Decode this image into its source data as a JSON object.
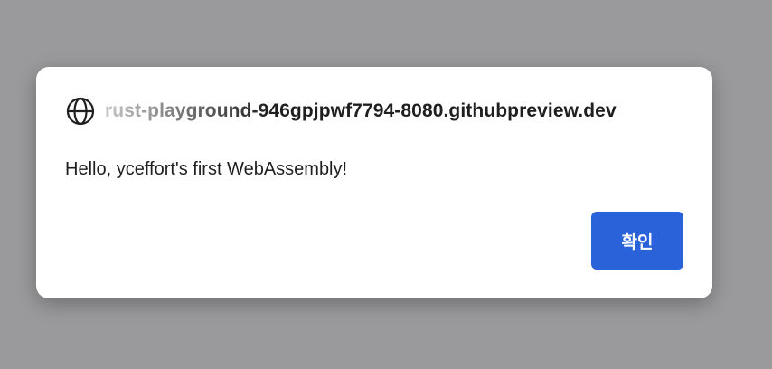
{
  "dialog": {
    "origin": "rust-playground-946gpjpwf7794-8080.githubpreview.dev",
    "origin_icon": "globe-icon",
    "message": "Hello, yceffort's first WebAssembly!",
    "ok_label": "확인"
  },
  "colors": {
    "overlay": "#9a9a9c",
    "dialog_background": "#ffffff",
    "button_background": "#2962d9",
    "button_text": "#ffffff",
    "text": "#1f1f1f"
  }
}
